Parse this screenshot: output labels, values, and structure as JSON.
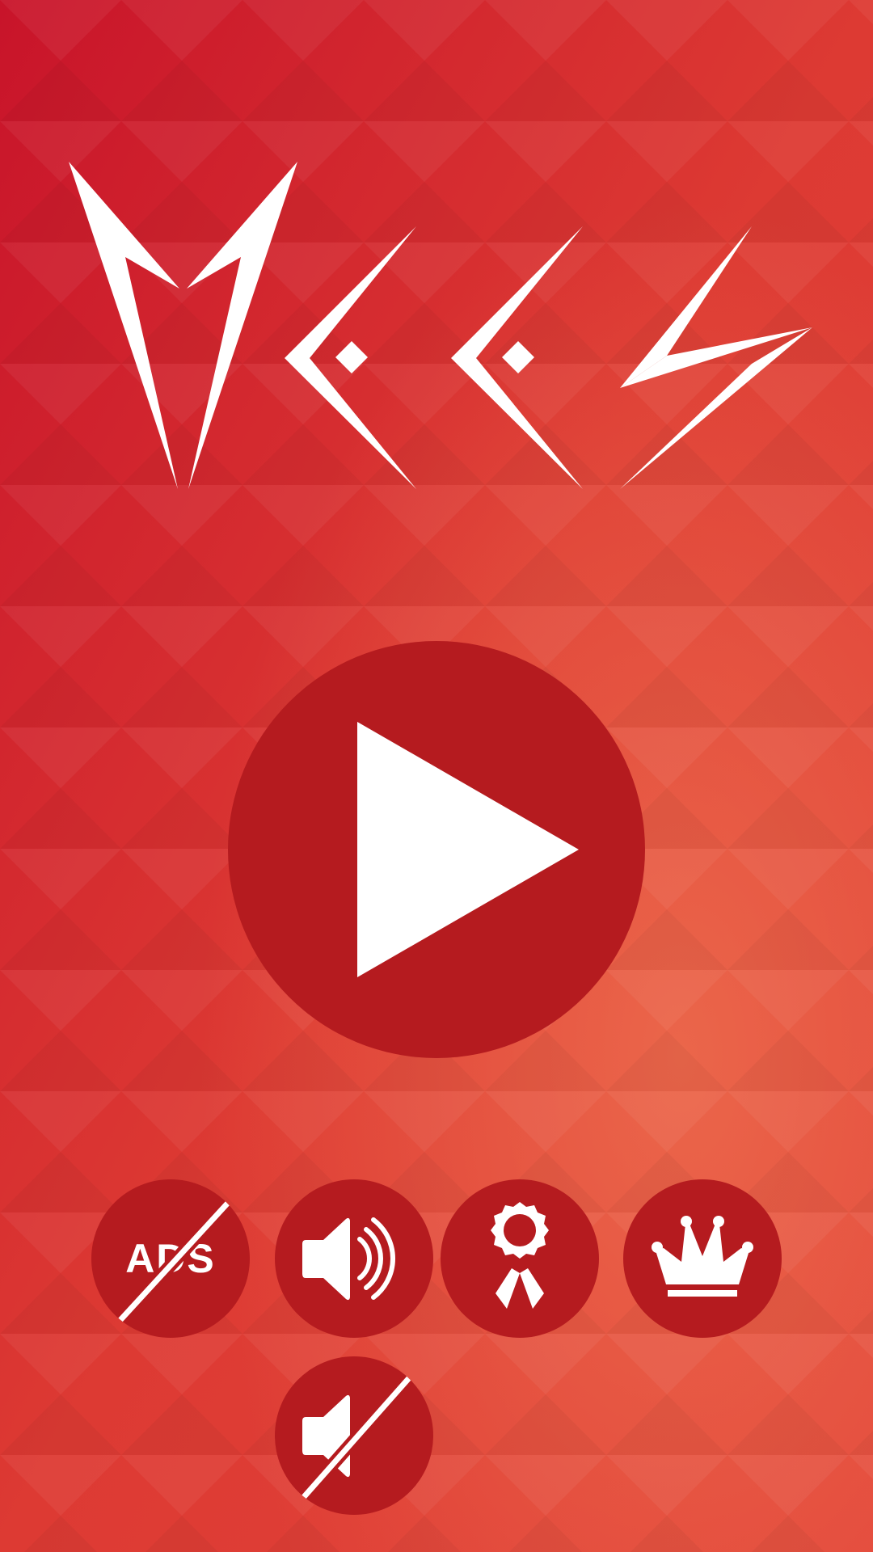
{
  "app": {
    "logo_text": "MEES"
  },
  "theme": {
    "background_top": "#c8142a",
    "background_mid": "#dd3a33",
    "background_glow": "#ea6448",
    "button_fill": "#b51b1f",
    "icon_color": "#ffffff"
  },
  "play_button": {
    "icon": "play-icon"
  },
  "menu_buttons": [
    {
      "id": "no-ads",
      "icon": "no-ads-icon",
      "label": "ADS"
    },
    {
      "id": "sound-on",
      "icon": "speaker-on-icon"
    },
    {
      "id": "achievements",
      "icon": "award-badge-icon"
    },
    {
      "id": "leaderboard",
      "icon": "crown-icon"
    },
    {
      "id": "sound-off",
      "icon": "speaker-muted-icon"
    }
  ]
}
